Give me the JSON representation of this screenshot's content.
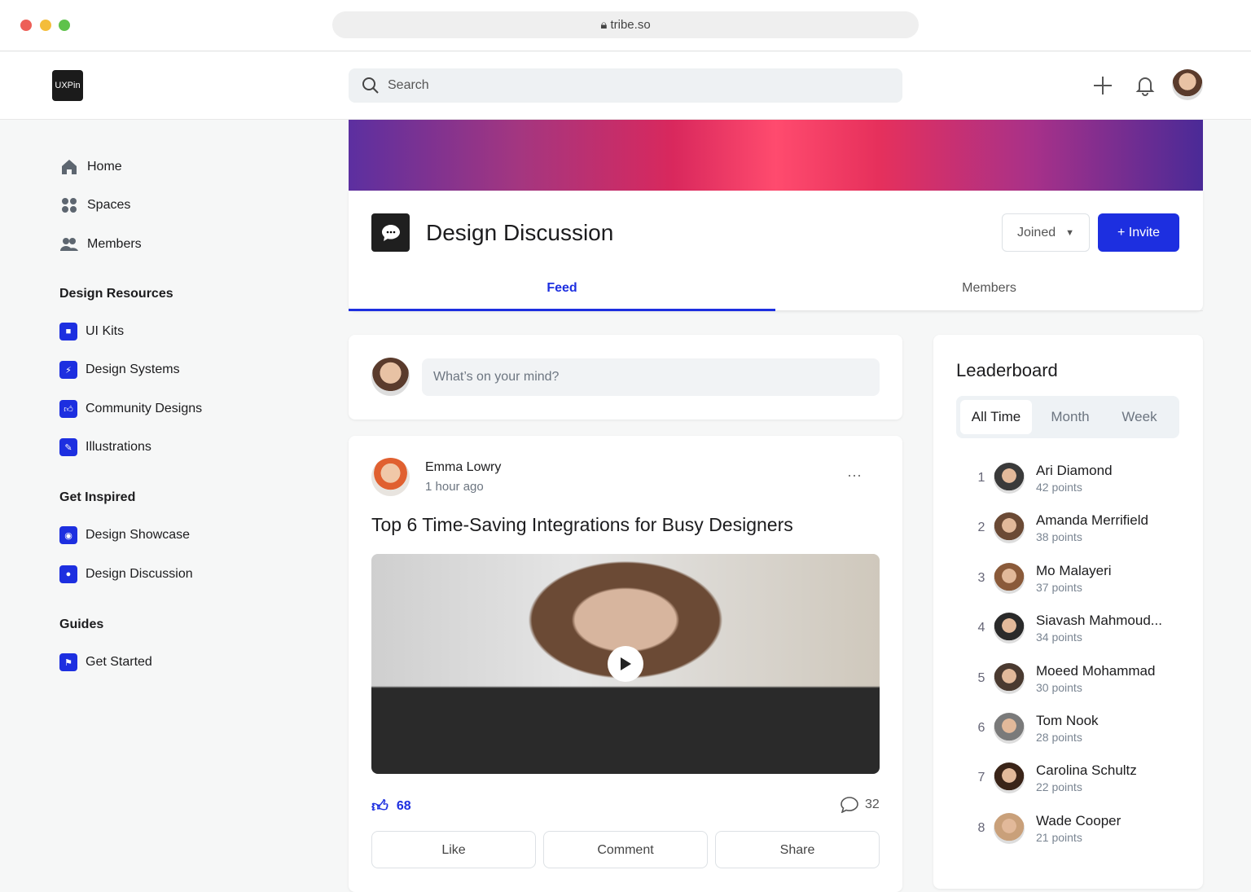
{
  "browser": {
    "url": "tribe.so",
    "colors": {
      "close": "#ed5f57",
      "min": "#f4bd3a",
      "max": "#5ec24b"
    }
  },
  "header": {
    "logo": "UXPin",
    "search_placeholder": "Search"
  },
  "sidebar": {
    "main": [
      {
        "label": "Home"
      },
      {
        "label": "Spaces"
      },
      {
        "label": "Members"
      }
    ],
    "sections": [
      {
        "title": "Design Resources",
        "items": [
          {
            "label": "UI Kits"
          },
          {
            "label": "Design Systems"
          },
          {
            "label": "Community Designs"
          },
          {
            "label": "Illustrations"
          }
        ]
      },
      {
        "title": "Get Inspired",
        "items": [
          {
            "label": "Design Showcase"
          },
          {
            "label": "Design Discussion"
          }
        ]
      },
      {
        "title": "Guides",
        "items": [
          {
            "label": "Get Started"
          }
        ]
      }
    ]
  },
  "space": {
    "title": "Design Discussion",
    "joined": "Joined",
    "invite": "+ Invite",
    "tabs": [
      "Feed",
      "Members"
    ],
    "accent": "#1d2fe0"
  },
  "composer": {
    "placeholder": "What’s on your mind?"
  },
  "post": {
    "author": "Emma Lowry",
    "time": "1 hour ago",
    "title": "Top 6 Time-Saving Integrations for Busy Designers",
    "likes": "68",
    "comments": "32",
    "actions": [
      "Like",
      "Comment",
      "Share"
    ],
    "more": "···"
  },
  "leaderboard": {
    "title": "Leaderboard",
    "tabs": [
      "All Time",
      "Month",
      "Week"
    ],
    "entries": [
      {
        "rank": "1",
        "name": "Ari Diamond",
        "points": "42 points"
      },
      {
        "rank": "2",
        "name": "Amanda Merrifield",
        "points": "38 points"
      },
      {
        "rank": "3",
        "name": "Mo Malayeri",
        "points": "37 points"
      },
      {
        "rank": "4",
        "name": "Siavash Mahmoud...",
        "points": "34 points"
      },
      {
        "rank": "5",
        "name": "Moeed Mohammad",
        "points": "30 points"
      },
      {
        "rank": "6",
        "name": "Tom Nook",
        "points": "28 points"
      },
      {
        "rank": "7",
        "name": "Carolina Schultz",
        "points": "22 points"
      },
      {
        "rank": "8",
        "name": "Wade Cooper",
        "points": "21 points"
      }
    ]
  }
}
